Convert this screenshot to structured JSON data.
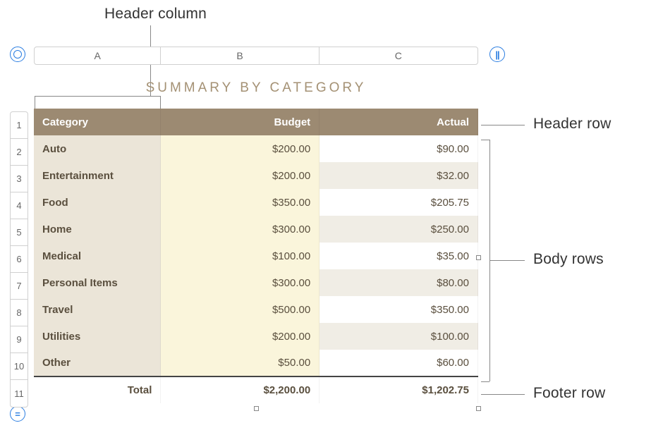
{
  "annotations": {
    "header_column": "Header column",
    "header_row": "Header row",
    "body_rows": "Body rows",
    "footer_row": "Footer row"
  },
  "column_letters": {
    "a": "A",
    "b": "B",
    "c": "C"
  },
  "row_numbers": [
    "1",
    "2",
    "3",
    "4",
    "5",
    "6",
    "7",
    "8",
    "9",
    "10",
    "11"
  ],
  "table": {
    "title": "SUMMARY BY CATEGORY",
    "headers": {
      "category": "Category",
      "budget": "Budget",
      "actual": "Actual"
    },
    "rows": [
      {
        "category": "Auto",
        "budget": "$200.00",
        "actual": "$90.00"
      },
      {
        "category": "Entertainment",
        "budget": "$200.00",
        "actual": "$32.00"
      },
      {
        "category": "Food",
        "budget": "$350.00",
        "actual": "$205.75"
      },
      {
        "category": "Home",
        "budget": "$300.00",
        "actual": "$250.00"
      },
      {
        "category": "Medical",
        "budget": "$100.00",
        "actual": "$35.00"
      },
      {
        "category": "Personal Items",
        "budget": "$300.00",
        "actual": "$80.00"
      },
      {
        "category": "Travel",
        "budget": "$500.00",
        "actual": "$350.00"
      },
      {
        "category": "Utilities",
        "budget": "$200.00",
        "actual": "$100.00"
      },
      {
        "category": "Other",
        "budget": "$50.00",
        "actual": "$60.00"
      }
    ],
    "footer": {
      "label": "Total",
      "budget": "$2,200.00",
      "actual": "$1,202.75"
    }
  },
  "chart_data": {
    "type": "table",
    "title": "SUMMARY BY CATEGORY",
    "columns": [
      "Category",
      "Budget",
      "Actual"
    ],
    "rows": [
      [
        "Auto",
        200.0,
        90.0
      ],
      [
        "Entertainment",
        200.0,
        32.0
      ],
      [
        "Food",
        350.0,
        205.75
      ],
      [
        "Home",
        300.0,
        250.0
      ],
      [
        "Medical",
        100.0,
        35.0
      ],
      [
        "Personal Items",
        300.0,
        80.0
      ],
      [
        "Travel",
        500.0,
        350.0
      ],
      [
        "Utilities",
        200.0,
        100.0
      ],
      [
        "Other",
        50.0,
        60.0
      ]
    ],
    "footer": [
      "Total",
      2200.0,
      1202.75
    ]
  }
}
